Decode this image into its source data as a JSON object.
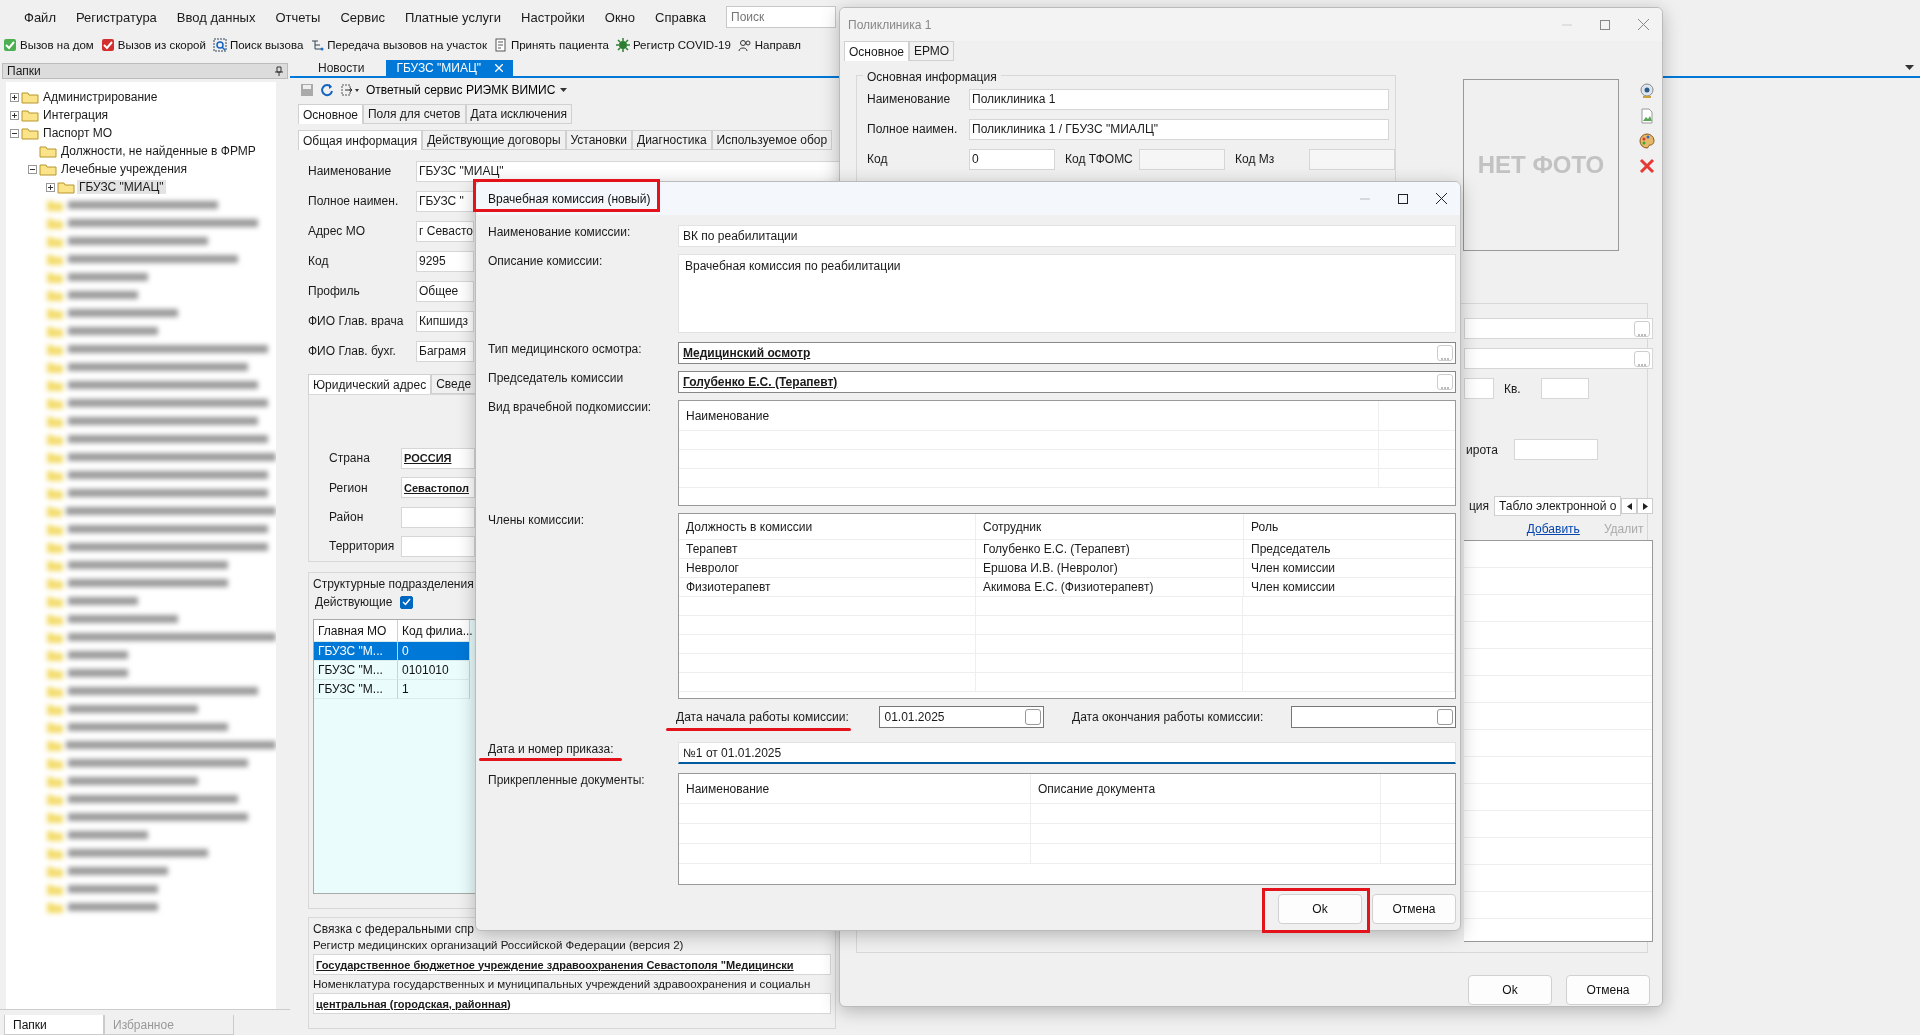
{
  "menu": [
    "Файл",
    "Регистратура",
    "Ввод данных",
    "Отчеты",
    "Сервис",
    "Платные услуги",
    "Настройки",
    "Окно",
    "Справка"
  ],
  "search": {
    "placeholder": "Поиск"
  },
  "toolbar": [
    {
      "kind": "house",
      "label": "Вызов на дом"
    },
    {
      "kind": "ambulance",
      "label": "Вызов из скорой"
    },
    {
      "kind": "find",
      "label": "Поиск вызова"
    },
    {
      "kind": "transfer",
      "label": "Передача вызовов на участок"
    },
    {
      "kind": "patient",
      "label": "Принять пациента"
    },
    {
      "kind": "virus",
      "label": "Регистр COVID-19"
    },
    {
      "kind": "referral",
      "label": "Направл"
    }
  ],
  "folders_panel": {
    "title": "Папки",
    "tree": [
      {
        "label": "Администрирование",
        "expanded": false,
        "selected": false
      },
      {
        "label": "Интеграция",
        "expanded": false,
        "selected": false
      },
      {
        "label": "Паспорт МО",
        "expanded": true,
        "selected": false,
        "children": [
          {
            "label": "Должности, не найденные в ФРМР",
            "selected": false
          },
          {
            "label": "Лечебные учреждения",
            "expanded": true,
            "selected": false,
            "children": [
              {
                "label": "ГБУЗС \"МИАЦ\"",
                "expanded": false,
                "selected": true
              }
            ]
          }
        ]
      }
    ],
    "bottom_tabs": [
      {
        "label": "Папки",
        "selected": true
      },
      {
        "label": "Избранное",
        "selected": false
      }
    ]
  },
  "document_tabs": [
    {
      "label": "Новости",
      "selected": false
    },
    {
      "label": "ГБУЗС \"МИАЦ\"",
      "selected": true
    }
  ],
  "document": {
    "service_menu": "Ответный сервис РИЭМК ВИМИС",
    "tabs": [
      {
        "label": "Основное",
        "selected": true
      },
      {
        "label": "Поля для счетов",
        "selected": false
      },
      {
        "label": "Дата исключения",
        "selected": false
      }
    ],
    "inner_tabs": [
      {
        "label": "Общая информация",
        "selected": true
      },
      {
        "label": "Действующие договоры",
        "selected": false
      },
      {
        "label": "Установки",
        "selected": false
      },
      {
        "label": "Диагностика",
        "selected": false
      },
      {
        "label": "Используемое обор",
        "selected": false
      }
    ],
    "fields": [
      {
        "label": "Наименование",
        "value": "ГБУЗС \"МИАЦ\""
      },
      {
        "label": "Полное наимен.",
        "value": "ГБУЗС \""
      },
      {
        "label": "Адрес МО",
        "value": "г Севасто"
      },
      {
        "label": "Код",
        "value": "9295"
      },
      {
        "label": "Профиль",
        "value": "Общее"
      },
      {
        "label": "ФИО Глав. врача",
        "value": "Кипшидз"
      },
      {
        "label": "ФИО Глав. бухг.",
        "value": "Баграмя"
      }
    ],
    "address_tabs": [
      {
        "label": "Юридический адрес",
        "selected": true
      },
      {
        "label": "Сведе",
        "selected": false
      }
    ],
    "address_fields": [
      {
        "label": "Страна",
        "value": "РОССИЯ"
      },
      {
        "label": "Регион",
        "value": "Севастопол"
      },
      {
        "label": "Район"
      },
      {
        "label": "Территория"
      }
    ],
    "subdivisions": {
      "title": "Структурные подразделения",
      "filter": {
        "label": "Действующие",
        "checked": true
      },
      "columns": [
        "Главная МО",
        "Код филиа..."
      ],
      "rows": [
        {
          "cells": [
            "ГБУЗС \"М...",
            "0"
          ],
          "selected": true
        },
        {
          "cells": [
            "ГБУЗС \"М...",
            "0101010"
          ],
          "selected": false
        },
        {
          "cells": [
            "ГБУЗС \"М...",
            "1"
          ],
          "selected": false
        }
      ]
    },
    "federal": {
      "title": "Связка с федеральными спр",
      "items": [
        {
          "label": "Регистр медицинских организаций Российской Федерации (версия 2)",
          "value": "Государственное бюджетное учреждение здравоохранения Севастополя \"Медицински"
        },
        {
          "label": "Номенклатура государственных и муниципальных учреждений здравоохранения и социальн",
          "value": "центральная (городская, районная)"
        }
      ]
    }
  },
  "polyclinic_window": {
    "title": "Поликлиника 1",
    "tabs": [
      {
        "label": "Основное",
        "selected": true
      },
      {
        "label": "ЕРМО",
        "selected": false
      }
    ],
    "main_info": {
      "title": "Основная информация",
      "fields": [
        {
          "label": "Наименование",
          "value": "Поликлиника 1"
        },
        {
          "label": "Полное наимен.",
          "value": "Поликлиника 1 / ГБУЗС \"МИАЛЦ\""
        }
      ],
      "codes": [
        {
          "label": "Код",
          "value": "0"
        },
        {
          "label": "Код ТФОМС"
        },
        {
          "label": "Код Мз"
        }
      ]
    },
    "photo_placeholder": "НЕТ ФОТО",
    "apartment_label": "Кв.",
    "latitude_label": "ирота",
    "lower_tabs": [
      {
        "label": "ция",
        "selected": false
      },
      {
        "label": "Табло электронной о",
        "selected": true
      }
    ],
    "actions": [
      {
        "label": "Добавить",
        "disabled": false
      },
      {
        "label": "Удалит",
        "disabled": true
      }
    ],
    "buttons": [
      "Ok",
      "Отмена"
    ]
  },
  "dialog": {
    "title": "Врачебная комиссия (новый)",
    "name": {
      "label": "Наименование комиссии:",
      "value": "ВК по реабилитации"
    },
    "description": {
      "label": "Описание комиссии:",
      "value": "Врачебная комиссия по реабилитации"
    },
    "exam_type": {
      "label": "Тип медицинского осмотра:",
      "value": "Медицинский осмотр"
    },
    "chairman": {
      "label": "Председатель комиссии",
      "value": "Голубенко Е.С. (Терапевт)"
    },
    "subcommission": {
      "label": "Вид врачебной подкомиссии:",
      "columns": [
        "Наименование"
      ]
    },
    "members": {
      "label": "Члены комиссии:",
      "columns": [
        "Должность в комиссии",
        "Сотрудник",
        "Роль"
      ],
      "rows": [
        [
          "Терапевт",
          "Голубенко Е.С. (Терапевт)",
          "Председатель"
        ],
        [
          "Невролог",
          "Ершова И.В. (Невролог)",
          "Член комиссии"
        ],
        [
          "Физиотерапевт",
          "Акимова Е.С. (Физиотерапевт)",
          "Член комиссии"
        ]
      ]
    },
    "start_date": {
      "label": "Дата начала работы комиссии:",
      "value": "01.01.2025",
      "checked": false
    },
    "end_date": {
      "label": "Дата окончания работы комиссии:",
      "checked": false
    },
    "order": {
      "label": "Дата и номер приказа:",
      "value": "№1 от 01.01.2025"
    },
    "documents": {
      "label": "Прикрепленные документы:",
      "columns": [
        "Наименование",
        "Описание документа"
      ]
    },
    "buttons": [
      "Ok",
      "Отмена"
    ]
  }
}
